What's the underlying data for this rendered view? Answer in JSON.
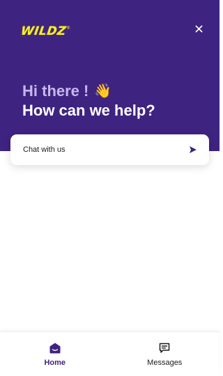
{
  "brand": {
    "logo_text": "WILDZ",
    "logo_mark": "®",
    "accent_color": "#3f2381",
    "logo_color": "#f5ef2a"
  },
  "header": {
    "close_icon": "close-icon",
    "greeting": "Hi there !",
    "greeting_emoji": "👋",
    "title": "How can we help?"
  },
  "chat_card": {
    "label": "Chat with us",
    "icon": "send-icon"
  },
  "nav": {
    "home": {
      "label": "Home",
      "icon": "home-icon",
      "active": true
    },
    "messages": {
      "label": "Messages",
      "icon": "messages-icon",
      "active": false
    }
  }
}
